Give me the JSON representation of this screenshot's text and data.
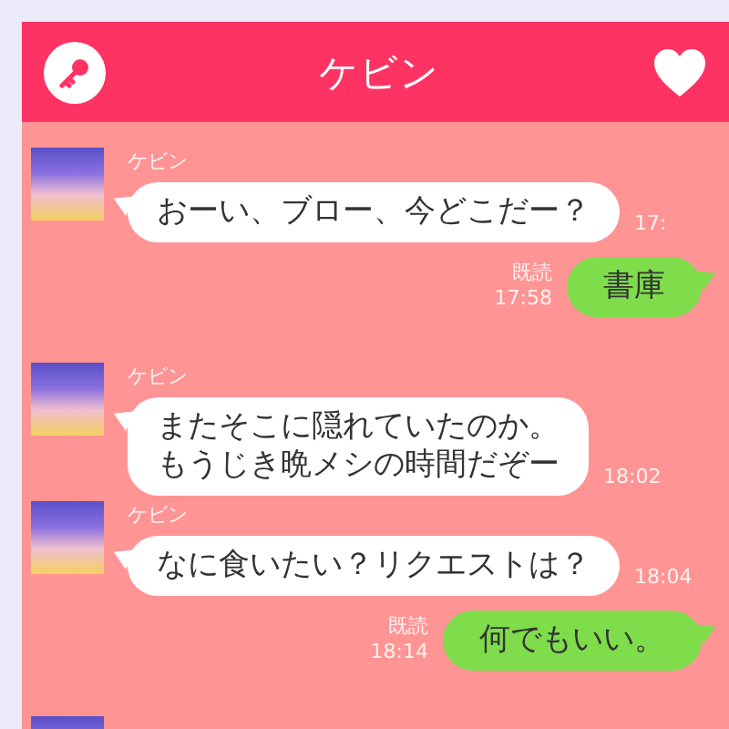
{
  "header": {
    "title": "ケビン"
  },
  "messages": [
    {
      "kind": "incoming",
      "name": "ケビン",
      "lines": [
        "おーい、ブロー、今どこだー？"
      ],
      "time": "17:"
    },
    {
      "kind": "outgoing",
      "read": "既読",
      "time": "17:58",
      "text": "書庫"
    },
    {
      "kind": "incoming",
      "name": "ケビン",
      "lines": [
        "またそこに隠れていたのか。",
        "もうじき晩メシの時間だぞー"
      ],
      "time": "18:02"
    },
    {
      "kind": "incoming",
      "name": "ケビン",
      "lines": [
        "なに食いたい？リクエストは？"
      ],
      "time": "18:04"
    },
    {
      "kind": "outgoing",
      "read": "既読",
      "time": "18:14",
      "text": "何でもいい。"
    },
    {
      "kind": "incoming"
    }
  ]
}
